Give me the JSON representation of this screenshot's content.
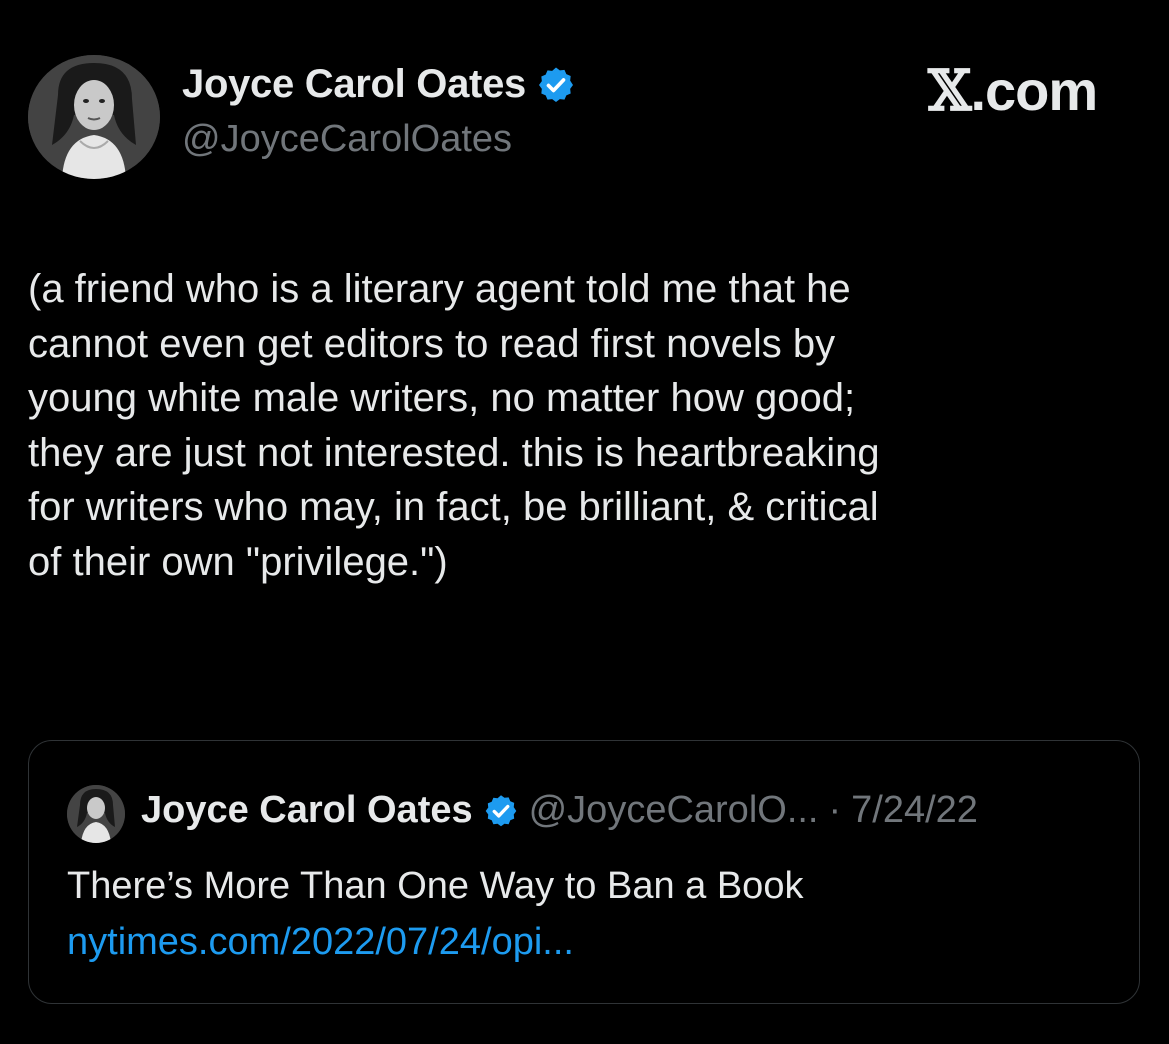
{
  "author": {
    "display_name": "Joyce Carol Oates",
    "handle": "@JoyceCarolOates",
    "verified_icon": "verified-badge-icon",
    "avatar": "author-avatar"
  },
  "brand": {
    "text_x": "𝕏",
    "text_domain": ".com"
  },
  "tweet": {
    "text": "(a friend who is a literary agent told me that he\ncannot even get editors to read first novels by\nyoung white male writers, no matter how good;\nthey are just not interested. this is heartbreaking\nfor writers who may, in fact, be brilliant, & critical\nof their own \"privilege.\")"
  },
  "quoted_tweet": {
    "display_name": "Joyce Carol Oates",
    "handle": "@JoyceCarolO...",
    "separator": "·",
    "date": "7/24/22",
    "title": "There’s More Than One Way to Ban a Book",
    "link": "nytimes.com/2022/07/24/opi..."
  },
  "colors": {
    "background": "#000000",
    "text": "#e7e9ea",
    "muted": "#71767b",
    "link": "#1d9bf0",
    "verified": "#1d9bf0",
    "border": "#2f3336"
  }
}
